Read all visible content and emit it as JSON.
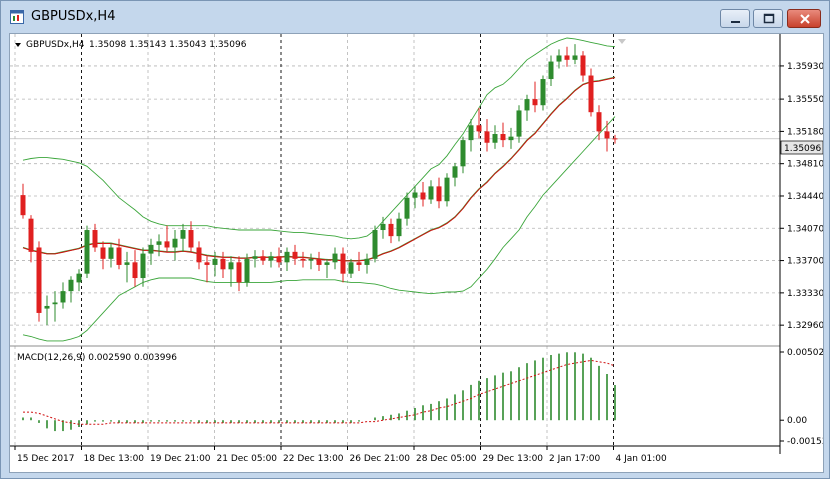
{
  "window": {
    "title": "GBPUSDx,H4",
    "minimize_icon": "minimize-icon",
    "maximize_icon": "maximize-icon",
    "close_icon": "close-icon"
  },
  "chart": {
    "info_prefix": "GBPUSDx,H4",
    "info_values": "1.35098 1.35143 1.35043 1.35096",
    "collapse_icon": "triangle-down-icon",
    "current_price_label": "1.35096",
    "macd_label": "MACD(12,26,9) 0.002590 0.003996",
    "colors": {
      "bull": "#2e8b2e",
      "bear": "#e02020",
      "band": "#3aa53a",
      "ma": "#d01010",
      "grid": "#b5b5b5"
    }
  },
  "chart_data": {
    "type": "candlestick",
    "title": "GBPUSDx,H4",
    "ohlc_shown": {
      "open": 1.35098,
      "high": 1.35143,
      "low": 1.35043,
      "close": 1.35096
    },
    "price_axis": [
      "1.35930",
      "1.35550",
      "1.35180",
      "1.34810",
      "1.34440",
      "1.34070",
      "1.33700",
      "1.33330",
      "1.32960"
    ],
    "ylim": [
      1.3279,
      1.3625
    ],
    "time_axis": [
      "15 Dec 2017",
      "18 Dec 13:00",
      "19 Dec 21:00",
      "21 Dec 05:00",
      "22 Dec 13:00",
      "26 Dec 21:00",
      "28 Dec 05:00",
      "29 Dec 13:00",
      "2 Jan 17:00",
      "4 Jan 01:00"
    ],
    "current_price": 1.35096,
    "candles": [
      [
        1.3445,
        1.3458,
        1.3418,
        1.3422
      ],
      [
        1.3418,
        1.3422,
        1.3368,
        1.338
      ],
      [
        1.3385,
        1.3392,
        1.33,
        1.331
      ],
      [
        1.3315,
        1.333,
        1.3296,
        1.3318
      ],
      [
        1.332,
        1.3335,
        1.33,
        1.3322
      ],
      [
        1.3322,
        1.3345,
        1.3315,
        1.3335
      ],
      [
        1.3335,
        1.3352,
        1.3322,
        1.3348
      ],
      [
        1.3345,
        1.336,
        1.3335,
        1.3355
      ],
      [
        1.3355,
        1.341,
        1.335,
        1.3405
      ],
      [
        1.3405,
        1.3412,
        1.338,
        1.3385
      ],
      [
        1.3385,
        1.3392,
        1.336,
        1.3372
      ],
      [
        1.3372,
        1.339,
        1.3362,
        1.3385
      ],
      [
        1.3385,
        1.3395,
        1.336,
        1.3365
      ],
      [
        1.3365,
        1.338,
        1.3345,
        1.3368
      ],
      [
        1.3368,
        1.3382,
        1.334,
        1.335
      ],
      [
        1.335,
        1.3385,
        1.334,
        1.3378
      ],
      [
        1.3378,
        1.3395,
        1.3365,
        1.3388
      ],
      [
        1.3388,
        1.34,
        1.3375,
        1.3392
      ],
      [
        1.3392,
        1.341,
        1.338,
        1.3385
      ],
      [
        1.3385,
        1.3405,
        1.337,
        1.3395
      ],
      [
        1.3395,
        1.3412,
        1.338,
        1.3405
      ],
      [
        1.3405,
        1.3415,
        1.338,
        1.3385
      ],
      [
        1.3385,
        1.3392,
        1.336,
        1.3368
      ],
      [
        1.3368,
        1.3375,
        1.3345,
        1.3365
      ],
      [
        1.3365,
        1.338,
        1.3352,
        1.3372
      ],
      [
        1.3372,
        1.338,
        1.335,
        1.336
      ],
      [
        1.336,
        1.3375,
        1.334,
        1.3368
      ],
      [
        1.3368,
        1.3375,
        1.3335,
        1.3345
      ],
      [
        1.3345,
        1.3378,
        1.334,
        1.3372
      ],
      [
        1.3372,
        1.3382,
        1.3362,
        1.3375
      ],
      [
        1.3375,
        1.3382,
        1.3365,
        1.337
      ],
      [
        1.337,
        1.338,
        1.3362,
        1.3375
      ],
      [
        1.3375,
        1.3385,
        1.3362,
        1.3368
      ],
      [
        1.3368,
        1.3385,
        1.3358,
        1.338
      ],
      [
        1.338,
        1.3388,
        1.3365,
        1.3372
      ],
      [
        1.3372,
        1.338,
        1.3362,
        1.337
      ],
      [
        1.337,
        1.3378,
        1.336,
        1.3372
      ],
      [
        1.3372,
        1.338,
        1.3358,
        1.3365
      ],
      [
        1.3365,
        1.3372,
        1.335,
        1.3368
      ],
      [
        1.3368,
        1.3385,
        1.336,
        1.3378
      ],
      [
        1.3378,
        1.3385,
        1.3345,
        1.3355
      ],
      [
        1.3355,
        1.3372,
        1.335,
        1.3368
      ],
      [
        1.3368,
        1.338,
        1.3358,
        1.3365
      ],
      [
        1.3365,
        1.3378,
        1.3355,
        1.3372
      ],
      [
        1.3372,
        1.341,
        1.3368,
        1.3405
      ],
      [
        1.3405,
        1.342,
        1.3395,
        1.3412
      ],
      [
        1.3412,
        1.3418,
        1.339,
        1.3398
      ],
      [
        1.3398,
        1.3425,
        1.3392,
        1.3418
      ],
      [
        1.3418,
        1.3448,
        1.341,
        1.3442
      ],
      [
        1.3442,
        1.3455,
        1.343,
        1.3448
      ],
      [
        1.3448,
        1.346,
        1.3432,
        1.344
      ],
      [
        1.344,
        1.3462,
        1.3435,
        1.3455
      ],
      [
        1.3455,
        1.3465,
        1.343,
        1.3438
      ],
      [
        1.3438,
        1.347,
        1.3432,
        1.3465
      ],
      [
        1.3465,
        1.3482,
        1.3455,
        1.3478
      ],
      [
        1.3478,
        1.3512,
        1.347,
        1.3508
      ],
      [
        1.3508,
        1.3532,
        1.3495,
        1.3525
      ],
      [
        1.3525,
        1.3545,
        1.351,
        1.3518
      ],
      [
        1.3518,
        1.3532,
        1.3495,
        1.3505
      ],
      [
        1.3505,
        1.3525,
        1.3498,
        1.3515
      ],
      [
        1.3515,
        1.3528,
        1.35,
        1.3508
      ],
      [
        1.3508,
        1.3522,
        1.3498,
        1.3512
      ],
      [
        1.3512,
        1.3548,
        1.3505,
        1.3542
      ],
      [
        1.3542,
        1.356,
        1.353,
        1.3555
      ],
      [
        1.3555,
        1.3575,
        1.354,
        1.3548
      ],
      [
        1.3548,
        1.3582,
        1.3542,
        1.3578
      ],
      [
        1.3578,
        1.3605,
        1.357,
        1.3598
      ],
      [
        1.3598,
        1.3612,
        1.359,
        1.3605
      ],
      [
        1.3605,
        1.3615,
        1.3592,
        1.36
      ],
      [
        1.36,
        1.3618,
        1.3595,
        1.3605
      ],
      [
        1.3605,
        1.361,
        1.3575,
        1.3582
      ],
      [
        1.3582,
        1.359,
        1.3535,
        1.354
      ],
      [
        1.354,
        1.3548,
        1.3508,
        1.3518
      ],
      [
        1.3518,
        1.353,
        1.3495,
        1.351
      ],
      [
        1.351,
        1.3514,
        1.3504,
        1.35096
      ]
    ],
    "indicators": {
      "moving_average": [
        1.3385,
        1.3382,
        1.338,
        1.3378,
        1.3378,
        1.338,
        1.3382,
        1.3384,
        1.3388,
        1.339,
        1.339,
        1.339,
        1.3388,
        1.3386,
        1.3384,
        1.3382,
        1.3382,
        1.3381,
        1.338,
        1.338,
        1.3381,
        1.338,
        1.3378,
        1.3376,
        1.3375,
        1.3374,
        1.3374,
        1.3373,
        1.3373,
        1.3374,
        1.3374,
        1.3374,
        1.3374,
        1.3375,
        1.3374,
        1.3374,
        1.3373,
        1.3372,
        1.3371,
        1.3371,
        1.337,
        1.337,
        1.337,
        1.3371,
        1.3374,
        1.3378,
        1.3381,
        1.3385,
        1.339,
        1.3395,
        1.34,
        1.3405,
        1.3408,
        1.3413,
        1.342,
        1.343,
        1.3442,
        1.3452,
        1.346,
        1.347,
        1.3478,
        1.3487,
        1.3497,
        1.3508,
        1.3516,
        1.3527,
        1.3538,
        1.3548,
        1.3556,
        1.3565,
        1.3572,
        1.3575,
        1.3576,
        1.3578,
        1.358
      ],
      "bollinger_upper": [
        1.3485,
        1.3487,
        1.3488,
        1.3488,
        1.3487,
        1.3486,
        1.3484,
        1.3482,
        1.3478,
        1.347,
        1.3462,
        1.3452,
        1.3442,
        1.3435,
        1.3428,
        1.342,
        1.3415,
        1.3412,
        1.341,
        1.341,
        1.341,
        1.341,
        1.341,
        1.341,
        1.3408,
        1.3407,
        1.3406,
        1.3405,
        1.3405,
        1.3405,
        1.3405,
        1.3405,
        1.3404,
        1.3403,
        1.3402,
        1.3402,
        1.3401,
        1.34,
        1.3399,
        1.3398,
        1.3396,
        1.3395,
        1.3396,
        1.3398,
        1.3405,
        1.3415,
        1.3425,
        1.3435,
        1.3445,
        1.3455,
        1.3465,
        1.3475,
        1.348,
        1.349,
        1.3503,
        1.3515,
        1.353,
        1.3545,
        1.356,
        1.3568,
        1.3572,
        1.358,
        1.359,
        1.36,
        1.3606,
        1.3612,
        1.3618,
        1.3622,
        1.3625,
        1.3624,
        1.3622,
        1.362,
        1.3618,
        1.3616,
        1.3615
      ],
      "bollinger_lower": [
        1.3285,
        1.3283,
        1.328,
        1.3278,
        1.3278,
        1.3278,
        1.328,
        1.3283,
        1.329,
        1.33,
        1.331,
        1.332,
        1.333,
        1.3335,
        1.334,
        1.3345,
        1.3348,
        1.335,
        1.335,
        1.335,
        1.335,
        1.335,
        1.3348,
        1.3346,
        1.3345,
        1.3345,
        1.3345,
        1.3345,
        1.3345,
        1.3345,
        1.3345,
        1.3345,
        1.3346,
        1.3347,
        1.3347,
        1.3348,
        1.3348,
        1.3348,
        1.3348,
        1.3348,
        1.3346,
        1.3345,
        1.3345,
        1.3344,
        1.3343,
        1.3341,
        1.3338,
        1.3336,
        1.3335,
        1.3334,
        1.3333,
        1.3332,
        1.3333,
        1.3334,
        1.3334,
        1.3335,
        1.334,
        1.335,
        1.336,
        1.3372,
        1.3385,
        1.3395,
        1.3405,
        1.342,
        1.3432,
        1.3445,
        1.3455,
        1.3465,
        1.3475,
        1.3485,
        1.3495,
        1.3505,
        1.3515,
        1.3525,
        1.3535
      ]
    },
    "macd": {
      "ylim": [
        -0.00153,
        0.00502
      ],
      "axis_labels": [
        "0.00502",
        "0.00",
        "-0.00153"
      ],
      "histogram": [
        0.0002,
        0.0002,
        -0.0002,
        -0.0006,
        -0.0008,
        -0.0008,
        -0.0007,
        -0.0005,
        -0.0003,
        -0.0001,
        -0.0001,
        -0.0001,
        -0.0002,
        -0.0002,
        -0.0002,
        -0.0002,
        -0.0001,
        -0.0001,
        -0.0001,
        -0.0001,
        -0.0001,
        -0.0001,
        -0.0002,
        -0.0002,
        -0.0002,
        -0.0002,
        -0.0002,
        -0.0002,
        -0.0002,
        -0.0002,
        -0.0002,
        -0.0002,
        -0.0002,
        -0.0002,
        -0.0002,
        -0.0002,
        -0.0002,
        -0.0002,
        -0.0002,
        -0.0002,
        -0.0002,
        -0.0002,
        -0.0001,
        0.0,
        0.0002,
        0.0003,
        0.0004,
        0.0005,
        0.0007,
        0.0009,
        0.0011,
        0.0012,
        0.0014,
        0.0016,
        0.0019,
        0.0022,
        0.0026,
        0.0029,
        0.0031,
        0.0033,
        0.0035,
        0.0036,
        0.0039,
        0.0042,
        0.0044,
        0.0046,
        0.0048,
        0.0049,
        0.005,
        0.005,
        0.0049,
        0.0046,
        0.004,
        0.0034,
        0.00259
      ],
      "signal": [
        0.0006,
        0.0006,
        0.0005,
        0.0003,
        0.0001,
        -0.0001,
        -0.0002,
        -0.0003,
        -0.0003,
        -0.0003,
        -0.0003,
        -0.0002,
        -0.0002,
        -0.0002,
        -0.0002,
        -0.0002,
        -0.0002,
        -0.0002,
        -0.0002,
        -0.0002,
        -0.0002,
        -0.0002,
        -0.0002,
        -0.0002,
        -0.0002,
        -0.0002,
        -0.0002,
        -0.0002,
        -0.0002,
        -0.0002,
        -0.0002,
        -0.0002,
        -0.0002,
        -0.0002,
        -0.0002,
        -0.0002,
        -0.0002,
        -0.0002,
        -0.0002,
        -0.0002,
        -0.0002,
        -0.0002,
        -0.0002,
        -0.0001,
        -0.0001,
        0.0,
        0.0001,
        0.0002,
        0.0003,
        0.0004,
        0.0006,
        0.0007,
        0.0009,
        0.001,
        0.0012,
        0.0014,
        0.0016,
        0.0019,
        0.0021,
        0.0023,
        0.0025,
        0.0027,
        0.0029,
        0.0031,
        0.0033,
        0.0035,
        0.0037,
        0.0039,
        0.0041,
        0.0042,
        0.0043,
        0.0044,
        0.0043,
        0.0042,
        0.003996
      ]
    },
    "legend": "none",
    "grid": true
  }
}
